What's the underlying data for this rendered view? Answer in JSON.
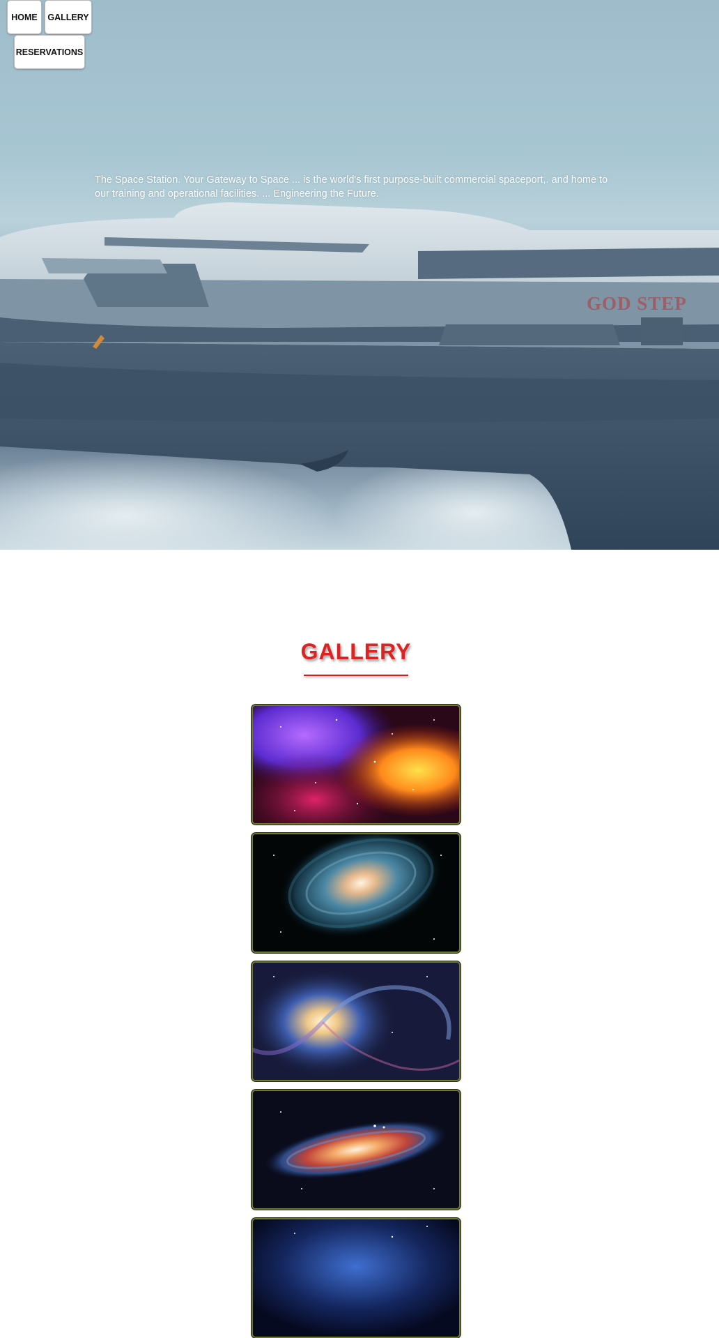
{
  "nav": {
    "home_label": "HOME",
    "gallery_label": "GALLERY",
    "reservations_label": "RESERVATIONS"
  },
  "hero": {
    "text": "The Space Station. Your Gateway to Space ... is the world's first purpose-built commercial spaceport,. and home to our training and operational facilities. ... Engineering the Future.",
    "ship_marking": "GOD STEP"
  },
  "gallery": {
    "title": "GALLERY",
    "images": [
      {
        "name": "colorful-nebula-image"
      },
      {
        "name": "spiral-galaxy-teal-image"
      },
      {
        "name": "spiral-galaxy-blue-image"
      },
      {
        "name": "edge-on-galaxy-image"
      },
      {
        "name": "blue-galaxy-image"
      }
    ]
  },
  "colors": {
    "title_red": "#dd2222",
    "thumb_border": "#6f7a2a"
  }
}
